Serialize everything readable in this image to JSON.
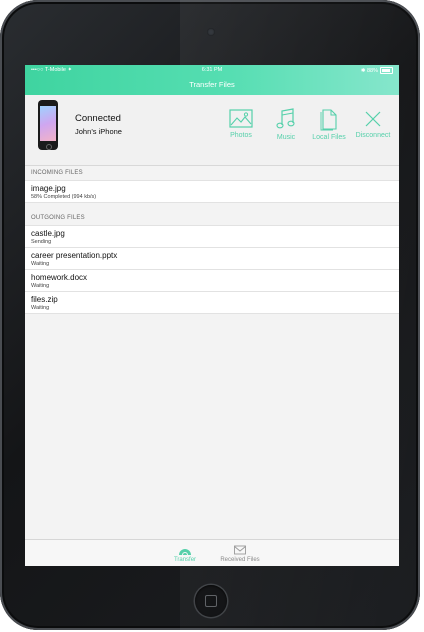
{
  "status_bar": {
    "carrier": "•••○○ T-Mobile ✦",
    "time": "6:31 PM",
    "battery": "✱ 88%"
  },
  "nav": {
    "title": "Transfer Files"
  },
  "device": {
    "status": "Connected",
    "name": "John’s iPhone"
  },
  "actions": [
    {
      "label": "Photos",
      "icon": "photos-icon"
    },
    {
      "label": "Music",
      "icon": "music-icon"
    },
    {
      "label": "Local Files",
      "icon": "local-files-icon"
    },
    {
      "label": "Disconnect",
      "icon": "disconnect-icon"
    }
  ],
  "incoming": {
    "header": "INCOMING FILES",
    "items": [
      {
        "name": "image.jpg",
        "status": "58% Completed (994 kb/s)"
      }
    ]
  },
  "outgoing": {
    "header": "OUTGOING FILES",
    "items": [
      {
        "name": "castle.jpg",
        "status": "Sending"
      },
      {
        "name": "career presentation.pptx",
        "status": "Waiting"
      },
      {
        "name": "homework.docx",
        "status": "Waiting"
      },
      {
        "name": "files.zip",
        "status": "Waiting"
      }
    ]
  },
  "tabs": [
    {
      "label": "Transfer",
      "icon": "transfer-icon",
      "active": true
    },
    {
      "label": "Received Files",
      "icon": "inbox-icon",
      "active": false
    }
  ],
  "colors": {
    "accent": "#55d0aa",
    "header_start": "#3fd4a0",
    "header_end": "#86e6cc"
  }
}
